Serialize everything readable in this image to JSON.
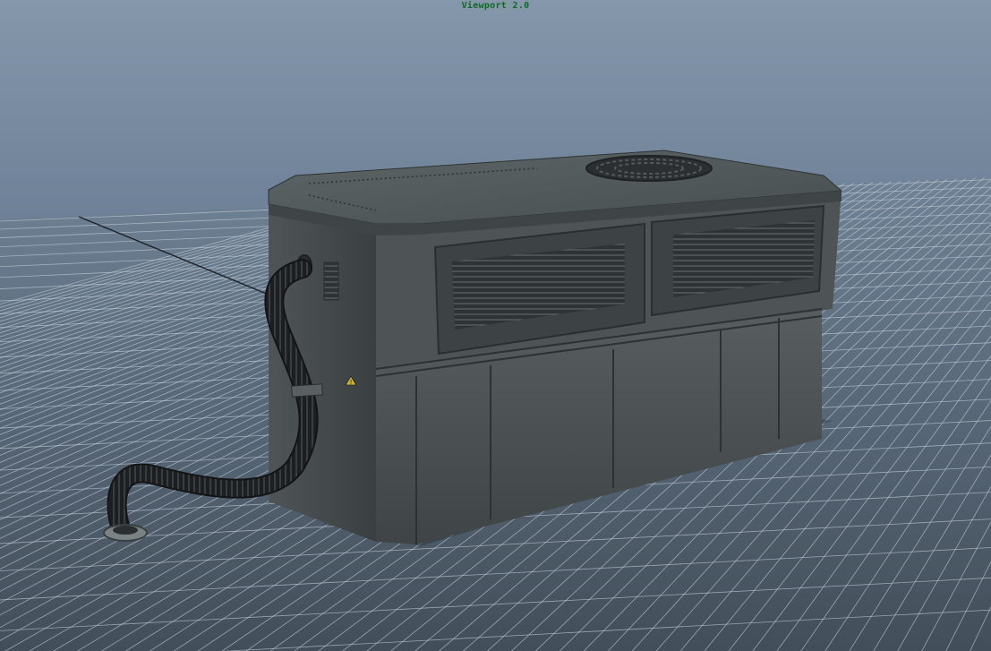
{
  "viewport": {
    "title": "Viewport 2.0"
  },
  "scene": {
    "object": "generator-box",
    "grid": true
  },
  "colors": {
    "background_top": "#8597aa",
    "background_bottom": "#46535f",
    "grid_line": "#c8d2dc",
    "title_text": "#0d6b24"
  },
  "icons": {
    "hose": "hose-icon",
    "vent": "vent-grille-icon",
    "fan": "fan-grille-icon",
    "warning": "warning-label-icon"
  }
}
